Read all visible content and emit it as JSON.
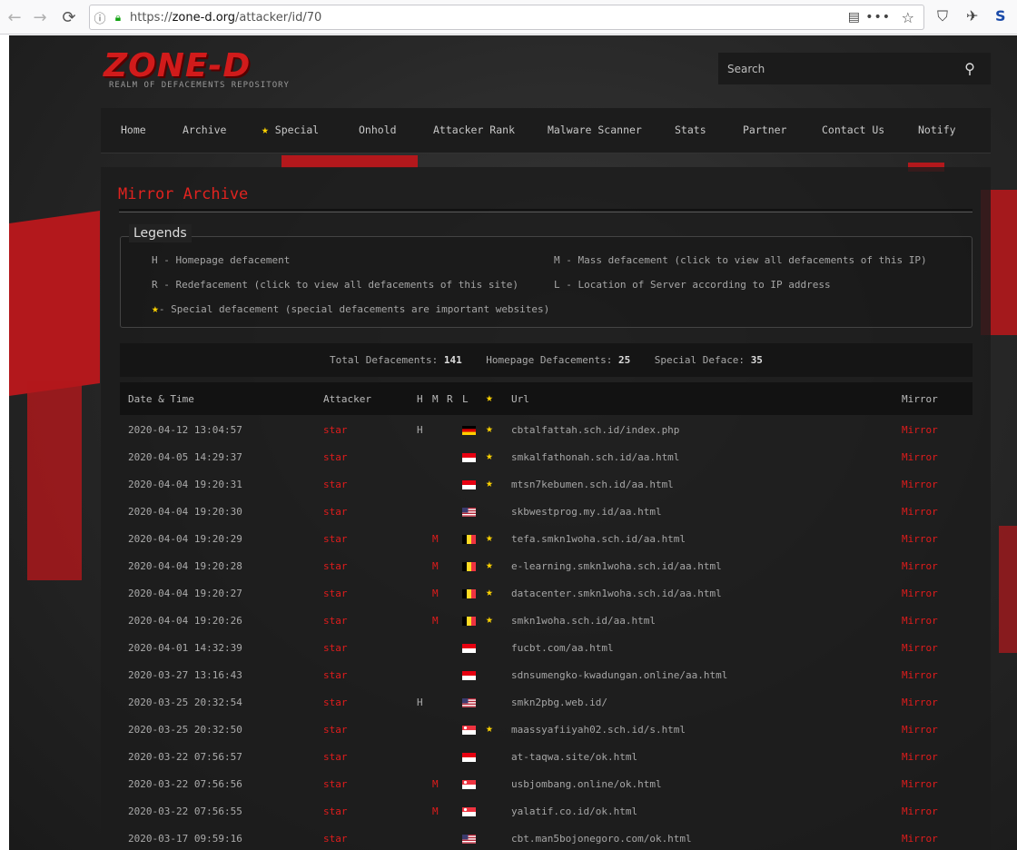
{
  "browser": {
    "back_icon": "←",
    "forward_icon": "→",
    "reload_icon": "⟳",
    "url_scheme": "https://",
    "url_host": "zone-d.org",
    "url_path": "/attacker/id/70",
    "ext_s": "S"
  },
  "site": {
    "logo": "ZONE-D",
    "tagline": "REALM OF DEFACEMENTS REPOSITORY",
    "search_placeholder": "Search",
    "accent": "#e01c1c",
    "star_color": "#ffd400"
  },
  "menu": [
    {
      "label": "Home"
    },
    {
      "label": "Archive"
    },
    {
      "label": "Special",
      "star": true
    },
    {
      "label": "Onhold"
    },
    {
      "label": "Attacker Rank"
    },
    {
      "label": "Malware Scanner"
    },
    {
      "label": "Stats"
    },
    {
      "label": "Partner"
    },
    {
      "label": "Contact Us"
    },
    {
      "label": "Notify"
    }
  ],
  "main": {
    "title": "Mirror Archive",
    "legend_title": "Legends",
    "legend": {
      "h": "H - Homepage defacement",
      "r": "R - Redefacement (click to view all defacements of this site)",
      "star": "- Special defacement (special defacements are important websites)",
      "m": "M - Mass defacement (click to view all defacements of this IP)",
      "l": "L - Location of Server according to IP address"
    },
    "stats": {
      "total_label": "Total Defacements:",
      "total": "141",
      "homepage_label": "Homepage Defacements:",
      "homepage": "25",
      "special_label": "Special Deface:",
      "special": "35"
    },
    "columns": {
      "date": "Date & Time",
      "attacker": "Attacker",
      "h": "H",
      "m": "M",
      "r": "R",
      "l": "L",
      "url": "Url",
      "mirror": "Mirror"
    },
    "rows": [
      {
        "date": "2020-04-12 13:04:57",
        "attacker": "star",
        "h": "H",
        "m": "",
        "flag": "de",
        "special": true,
        "url": "cbtalfattah.sch.id/index.php",
        "mirror": "Mirror"
      },
      {
        "date": "2020-04-05 14:29:37",
        "attacker": "star",
        "h": "",
        "m": "",
        "flag": "id",
        "special": true,
        "url": "smkalfathonah.sch.id/aa.html",
        "mirror": "Mirror"
      },
      {
        "date": "2020-04-04 19:20:31",
        "attacker": "star",
        "h": "",
        "m": "",
        "flag": "id",
        "special": true,
        "url": "mtsn7kebumen.sch.id/aa.html",
        "mirror": "Mirror"
      },
      {
        "date": "2020-04-04 19:20:30",
        "attacker": "star",
        "h": "",
        "m": "",
        "flag": "us",
        "special": false,
        "url": "skbwestprog.my.id/aa.html",
        "mirror": "Mirror"
      },
      {
        "date": "2020-04-04 19:20:29",
        "attacker": "star",
        "h": "",
        "m": "M",
        "flag": "be",
        "special": true,
        "url": "tefa.smkn1woha.sch.id/aa.html",
        "mirror": "Mirror"
      },
      {
        "date": "2020-04-04 19:20:28",
        "attacker": "star",
        "h": "",
        "m": "M",
        "flag": "be",
        "special": true,
        "url": "e-learning.smkn1woha.sch.id/aa.html",
        "mirror": "Mirror"
      },
      {
        "date": "2020-04-04 19:20:27",
        "attacker": "star",
        "h": "",
        "m": "M",
        "flag": "be",
        "special": true,
        "url": "datacenter.smkn1woha.sch.id/aa.html",
        "mirror": "Mirror"
      },
      {
        "date": "2020-04-04 19:20:26",
        "attacker": "star",
        "h": "",
        "m": "M",
        "flag": "be",
        "special": true,
        "url": "smkn1woha.sch.id/aa.html",
        "mirror": "Mirror"
      },
      {
        "date": "2020-04-01 14:32:39",
        "attacker": "star",
        "h": "",
        "m": "",
        "flag": "id",
        "special": false,
        "url": "fucbt.com/aa.html",
        "mirror": "Mirror"
      },
      {
        "date": "2020-03-27 13:16:43",
        "attacker": "star",
        "h": "",
        "m": "",
        "flag": "id",
        "special": false,
        "url": "sdnsumengko-kwadungan.online/aa.html",
        "mirror": "Mirror"
      },
      {
        "date": "2020-03-25 20:32:54",
        "attacker": "star",
        "h": "H",
        "m": "",
        "flag": "us",
        "special": false,
        "url": "smkn2pbg.web.id/",
        "mirror": "Mirror"
      },
      {
        "date": "2020-03-25 20:32:50",
        "attacker": "star",
        "h": "",
        "m": "",
        "flag": "sg",
        "special": true,
        "url": "maassyafiiyah02.sch.id/s.html",
        "mirror": "Mirror"
      },
      {
        "date": "2020-03-22 07:56:57",
        "attacker": "star",
        "h": "",
        "m": "",
        "flag": "id",
        "special": false,
        "url": "at-taqwa.site/ok.html",
        "mirror": "Mirror"
      },
      {
        "date": "2020-03-22 07:56:56",
        "attacker": "star",
        "h": "",
        "m": "M",
        "flag": "sg",
        "special": false,
        "url": "usbjombang.online/ok.html",
        "mirror": "Mirror"
      },
      {
        "date": "2020-03-22 07:56:55",
        "attacker": "star",
        "h": "",
        "m": "M",
        "flag": "sg",
        "special": false,
        "url": "yalatif.co.id/ok.html",
        "mirror": "Mirror"
      },
      {
        "date": "2020-03-17 09:59:16",
        "attacker": "star",
        "h": "",
        "m": "",
        "flag": "us",
        "special": false,
        "url": "cbt.man5bojonegoro.com/ok.html",
        "mirror": "Mirror"
      }
    ]
  }
}
